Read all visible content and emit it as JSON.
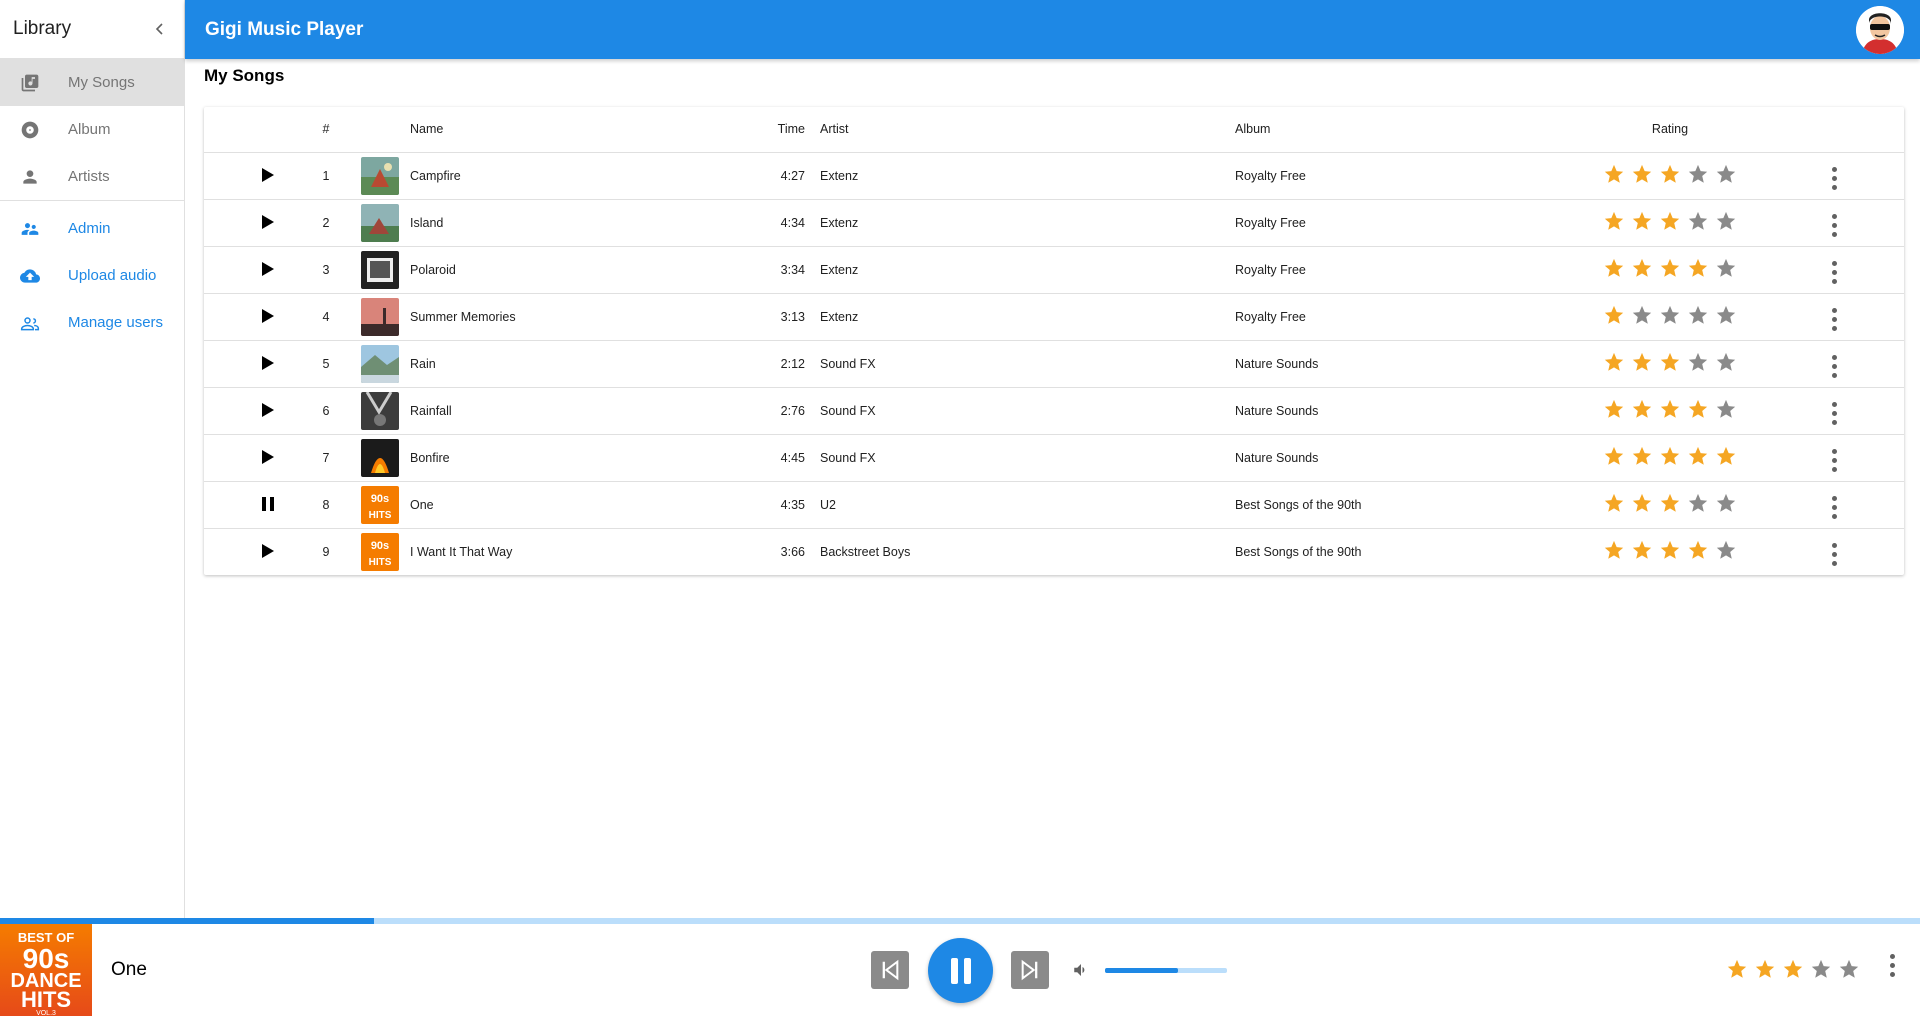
{
  "sidebar": {
    "title": "Library",
    "items": [
      {
        "label": "My Songs",
        "icon": "library-music-icon"
      },
      {
        "label": "Album",
        "icon": "album-icon"
      },
      {
        "label": "Artists",
        "icon": "person-icon"
      }
    ],
    "admin_items": [
      {
        "label": "Admin",
        "icon": "supervisor-icon"
      },
      {
        "label": "Upload audio",
        "icon": "cloud-upload-icon"
      },
      {
        "label": "Manage users",
        "icon": "people-outline-icon"
      }
    ]
  },
  "header": {
    "title": "Gigi Music Player"
  },
  "main": {
    "title": "My Songs",
    "columns": {
      "num": "#",
      "name": "Name",
      "time": "Time",
      "artist": "Artist",
      "album": "Album",
      "rating": "Rating"
    },
    "songs": [
      {
        "num": "1",
        "name": "Campfire",
        "time": "4:27",
        "artist": "Extenz",
        "album": "Royalty Free",
        "rating": 3,
        "playing": false
      },
      {
        "num": "2",
        "name": "Island",
        "time": "4:34",
        "artist": "Extenz",
        "album": "Royalty Free",
        "rating": 3,
        "playing": false
      },
      {
        "num": "3",
        "name": "Polaroid",
        "time": "3:34",
        "artist": "Extenz",
        "album": "Royalty Free",
        "rating": 4,
        "playing": false
      },
      {
        "num": "4",
        "name": "Summer Memories",
        "time": "3:13",
        "artist": "Extenz",
        "album": "Royalty Free",
        "rating": 1,
        "playing": false
      },
      {
        "num": "5",
        "name": "Rain",
        "time": "2:12",
        "artist": "Sound FX",
        "album": "Nature Sounds",
        "rating": 3,
        "playing": false
      },
      {
        "num": "6",
        "name": "Rainfall",
        "time": "2:76",
        "artist": "Sound FX",
        "album": "Nature Sounds",
        "rating": 4,
        "playing": false
      },
      {
        "num": "7",
        "name": "Bonfire",
        "time": "4:45",
        "artist": "Sound FX",
        "album": "Nature Sounds",
        "rating": 5,
        "playing": false
      },
      {
        "num": "8",
        "name": "One",
        "time": "4:35",
        "artist": "U2",
        "album": "Best Songs of the 90th",
        "rating": 3,
        "playing": true
      },
      {
        "num": "9",
        "name": "I Want It That Way",
        "time": "3:66",
        "artist": "Backstreet Boys",
        "album": "Best Songs of the 90th",
        "rating": 4,
        "playing": false
      }
    ]
  },
  "player": {
    "title": "One",
    "rating": 3,
    "progress": 0.195,
    "volume": 0.6,
    "cover_text": [
      "BEST OF",
      "90s",
      "DANCE",
      "HITS",
      "VOL.3"
    ]
  },
  "colors": {
    "accent": "#1e88e5",
    "star_on": "#f5a623",
    "star_off": "#8a8a8a"
  }
}
